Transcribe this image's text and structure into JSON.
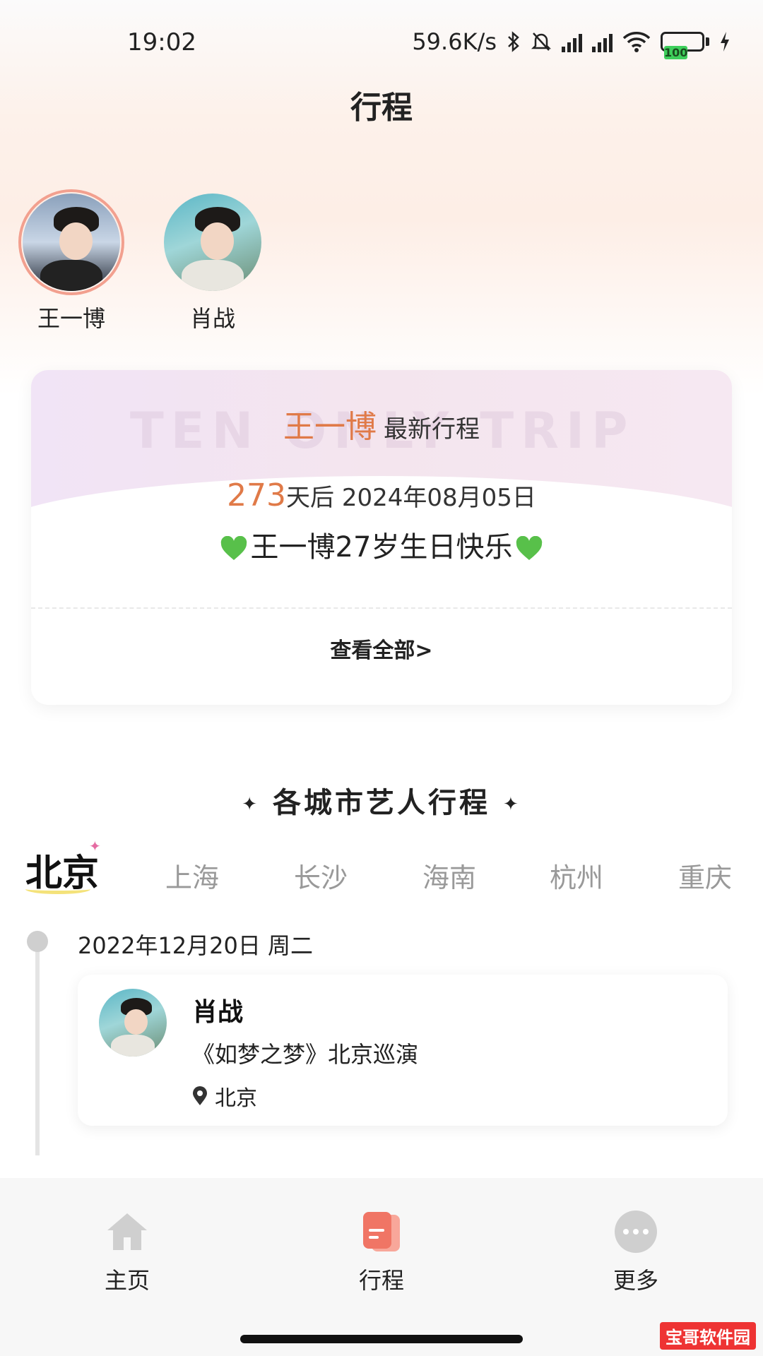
{
  "status_bar": {
    "time": "19:02",
    "net_speed": "59.6K/s",
    "battery": "100"
  },
  "header": {
    "title": "行程"
  },
  "artists": [
    {
      "name": "王一博",
      "selected": true
    },
    {
      "name": "肖战",
      "selected": false
    }
  ],
  "latest": {
    "artist": "王一博",
    "label": "最新行程",
    "days": "273",
    "days_suffix": "天后 2024年08月05日",
    "event": "王一博27岁生日快乐",
    "view_all": "查看全部>",
    "watermark": "TEN ONLY TRIP"
  },
  "section": {
    "title": "各城市艺人行程"
  },
  "cities": [
    "北京",
    "上海",
    "长沙",
    "海南",
    "杭州",
    "重庆"
  ],
  "active_city": "北京",
  "timeline": {
    "date": "2022年12月20日 周二",
    "event": {
      "artist": "肖战",
      "title": "《如梦之梦》北京巡演",
      "location": "北京"
    }
  },
  "nav": {
    "home": "主页",
    "schedule": "行程",
    "more": "更多"
  },
  "watermark_badge": "宝哥软件园",
  "colors": {
    "accent_orange": "#e07a48",
    "heart_green": "#58c04a",
    "nav_active": "#f07565"
  }
}
